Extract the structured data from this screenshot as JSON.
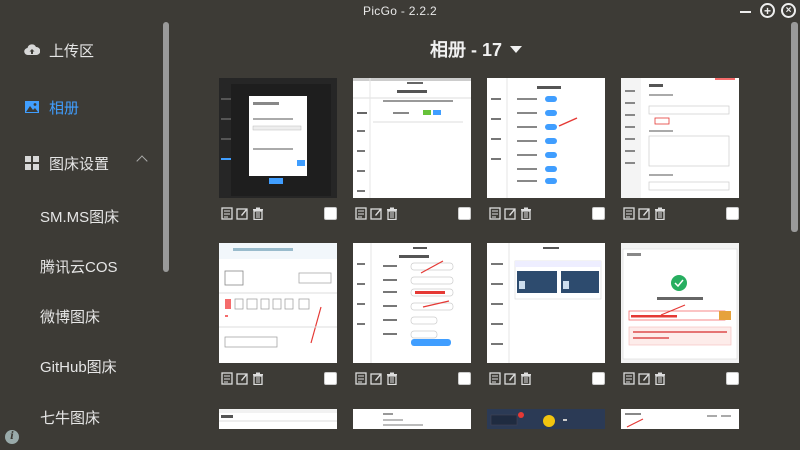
{
  "window": {
    "title": "PicGo - 2.2.2"
  },
  "sidebar": {
    "items": [
      {
        "label": "上传区",
        "icon": "cloud-upload-icon"
      },
      {
        "label": "相册",
        "icon": "image-icon",
        "active": true
      },
      {
        "label": "图床设置",
        "icon": "grid-icon",
        "expanded": true
      }
    ],
    "sub_items": [
      {
        "label": "SM.MS图床"
      },
      {
        "label": "腾讯云COS"
      },
      {
        "label": "微博图床"
      },
      {
        "label": "GitHub图床"
      },
      {
        "label": "七牛图床"
      }
    ]
  },
  "gallery": {
    "title": "相册 - 17",
    "count": 17,
    "visible_thumbnails": 12
  },
  "colors": {
    "accent": "#409eff",
    "background": "#3d3b36",
    "text": "#e6e6e6"
  }
}
